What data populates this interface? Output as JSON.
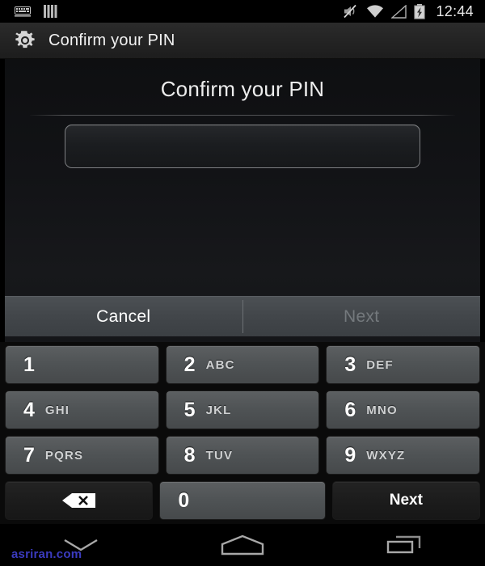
{
  "status_bar": {
    "icons_left": [
      "keyboard-icon",
      "vertical-bars-icon"
    ],
    "icons_right": [
      "mute-icon",
      "wifi-icon",
      "signal-icon",
      "battery-charging-icon"
    ],
    "time": "12:44"
  },
  "action_bar": {
    "icon": "gear-icon",
    "title": "Confirm your PIN"
  },
  "main": {
    "heading": "Confirm your PIN",
    "pin_input": {
      "value": "",
      "placeholder": ""
    }
  },
  "button_bar": {
    "cancel_label": "Cancel",
    "next_label": "Next",
    "next_enabled": false
  },
  "keypad": {
    "rows": [
      [
        {
          "digit": "1",
          "letters": "",
          "type": "num"
        },
        {
          "digit": "2",
          "letters": "ABC",
          "type": "num"
        },
        {
          "digit": "3",
          "letters": "DEF",
          "type": "num"
        }
      ],
      [
        {
          "digit": "4",
          "letters": "GHI",
          "type": "num"
        },
        {
          "digit": "5",
          "letters": "JKL",
          "type": "num"
        },
        {
          "digit": "6",
          "letters": "MNO",
          "type": "num"
        }
      ],
      [
        {
          "digit": "7",
          "letters": "PQRS",
          "type": "num"
        },
        {
          "digit": "8",
          "letters": "TUV",
          "type": "num"
        },
        {
          "digit": "9",
          "letters": "WXYZ",
          "type": "num"
        }
      ],
      [
        {
          "digit": "",
          "letters": "",
          "type": "fn",
          "icon": "backspace-icon",
          "label": ""
        },
        {
          "digit": "0",
          "letters": "",
          "type": "num"
        },
        {
          "digit": "",
          "letters": "",
          "type": "fn",
          "label": "Next"
        }
      ]
    ]
  },
  "nav_bar": {
    "back_icon": "keyboard-dismiss-icon",
    "home_icon": "home-icon",
    "recents_icon": "recents-icon"
  },
  "watermark": {
    "text": "asriran.com",
    "color": "#3b3bbf"
  },
  "colors": {
    "background": "#000000",
    "action_bar": "#232323",
    "key_num": "#4f5355",
    "key_fn": "#1c1c1c",
    "button_bar": "#42464a",
    "text_primary": "#ffffff",
    "text_disabled": "#74797d"
  }
}
